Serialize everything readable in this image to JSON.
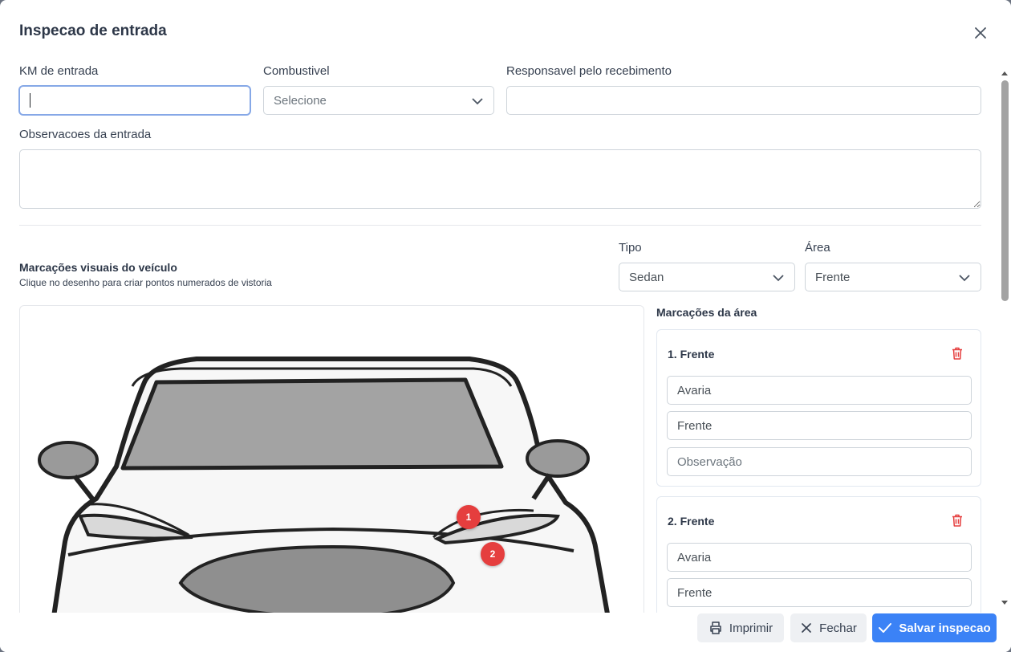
{
  "modal": {
    "title": "Inspecao de entrada"
  },
  "fields": {
    "km_label": "KM de entrada",
    "km_value": "",
    "fuel_label": "Combustivel",
    "fuel_placeholder": "Selecione",
    "responsible_label": "Responsavel pelo recebimento",
    "responsible_value": "",
    "notes_label": "Observacoes da entrada",
    "notes_value": ""
  },
  "visual": {
    "title": "Marcações visuais do veículo",
    "subtitle": "Clique no desenho para criar pontos numerados de vistoria",
    "type_label": "Tipo",
    "type_value": "Sedan",
    "area_label": "Área",
    "area_value": "Frente",
    "markers": [
      "1",
      "2"
    ]
  },
  "marks": {
    "title": "Marcações da área",
    "items": [
      {
        "title": "1. Frente",
        "kind": "Avaria",
        "area": "Frente",
        "obs_placeholder": "Observação"
      },
      {
        "title": "2. Frente",
        "kind": "Avaria",
        "area": "Frente"
      }
    ]
  },
  "footer": {
    "print_label": "Imprimir",
    "close_label": "Fechar",
    "save_label": "Salvar inspecao"
  },
  "colors": {
    "primary": "#3b82f6",
    "danger": "#e53e3e",
    "marker": "#e53e3e"
  },
  "icons": {
    "close": "close-icon",
    "chevron": "chevron-down-icon",
    "trash": "trash-icon",
    "print": "printer-icon",
    "x": "x-icon",
    "check": "check-icon"
  }
}
